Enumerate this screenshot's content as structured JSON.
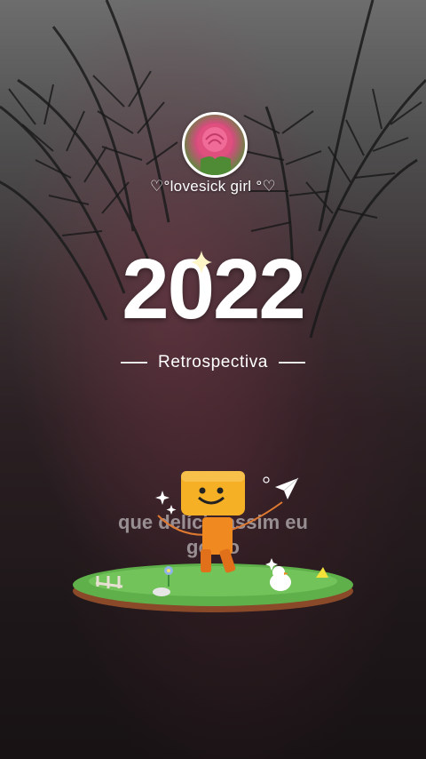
{
  "profile": {
    "username": "♡°lovesick girl °♡"
  },
  "header": {
    "year": "2022",
    "subtitle": "Retrospectiva"
  },
  "caption": {
    "line1": "que delícia assim eu",
    "line2": "gosto"
  },
  "colors": {
    "text": "#ffffff",
    "avatar_border": "#ffffff",
    "mascot": "#f5a623",
    "grass": "#5fb04a"
  },
  "icons": {
    "sparkle": "sparkle-icon",
    "paper_plane": "paper-plane-icon"
  }
}
